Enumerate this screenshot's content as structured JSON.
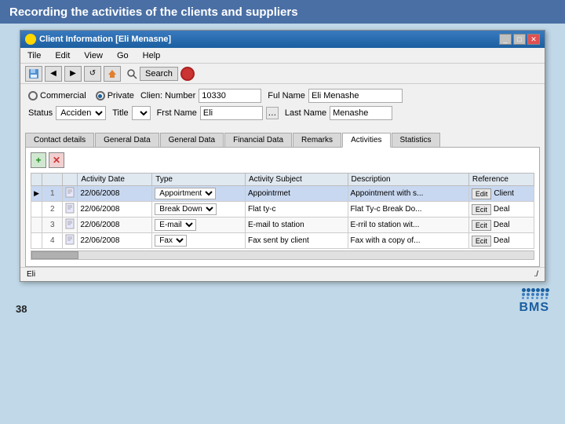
{
  "header": {
    "title": "Recording the activities of the clients and suppliers"
  },
  "window": {
    "title": "Client Information [Eli Menasne]",
    "icon": "client-icon"
  },
  "window_controls": {
    "minimize": "_",
    "maximize": "□",
    "close": "✕"
  },
  "menu": {
    "items": [
      "Tile",
      "Edit",
      "View",
      "Go",
      "Help"
    ]
  },
  "toolbar": {
    "search_label": "Search",
    "buttons": [
      "save",
      "back",
      "forward",
      "refresh",
      "home"
    ]
  },
  "form": {
    "radio_commercial": "Commercial",
    "radio_private": "Private",
    "clien_number_label": "Clien: Number",
    "clien_number_value": "10330",
    "full_name_label": "Ful Name",
    "full_name_value": "Eli Menashe",
    "status_label": "Status",
    "status_value": "Acciden",
    "title_label": "Title",
    "first_name_label": "Frst Name",
    "first_name_value": "Eli",
    "last_name_label": "Last Name",
    "last_name_value": "Menashe"
  },
  "tabs": {
    "items": [
      "Contact details",
      "General Data",
      "General Data",
      "Financial Data",
      "Remarks",
      "Activities",
      "Statistics"
    ],
    "active": "Activities"
  },
  "activities": {
    "toolbar": {
      "add_label": "+",
      "delete_label": "✕"
    },
    "table": {
      "columns": [
        "",
        "",
        "Activity Date",
        "Type",
        "Activity Subject",
        "Description",
        "Reference"
      ],
      "rows": [
        {
          "indicator": "▶",
          "num": "1",
          "icon": "📄",
          "date": "22/06/2008",
          "type": "Appoirtment",
          "subject": "Appointrmet",
          "description": "Appointment with s...",
          "edit": "Edit",
          "reference": "Client"
        },
        {
          "indicator": "",
          "num": "2",
          "icon": "📄",
          "date": "22/06/2008",
          "type": "Break Down",
          "subject": "Flat ty-c",
          "description": "Flat Ty-c Break Do...",
          "edit": "Ecit",
          "reference": "Deal"
        },
        {
          "indicator": "",
          "num": "3",
          "icon": "📄",
          "date": "22/06/2008",
          "type": "E-mail",
          "subject": "E-mail to station",
          "description": "E-rril to station wit...",
          "edit": "Ecit",
          "reference": "Deal"
        },
        {
          "indicator": "",
          "num": "4",
          "icon": "📄",
          "date": "22/06/2008",
          "type": "Fax",
          "subject": "Fax sent by client",
          "description": "Fax with a copy of...",
          "edit": "Ecit",
          "reference": "Deal"
        }
      ]
    }
  },
  "status_bar": {
    "left": "Eli",
    "right": "./"
  },
  "footer": {
    "page_number": "38"
  },
  "bms": {
    "text": "BMS"
  }
}
